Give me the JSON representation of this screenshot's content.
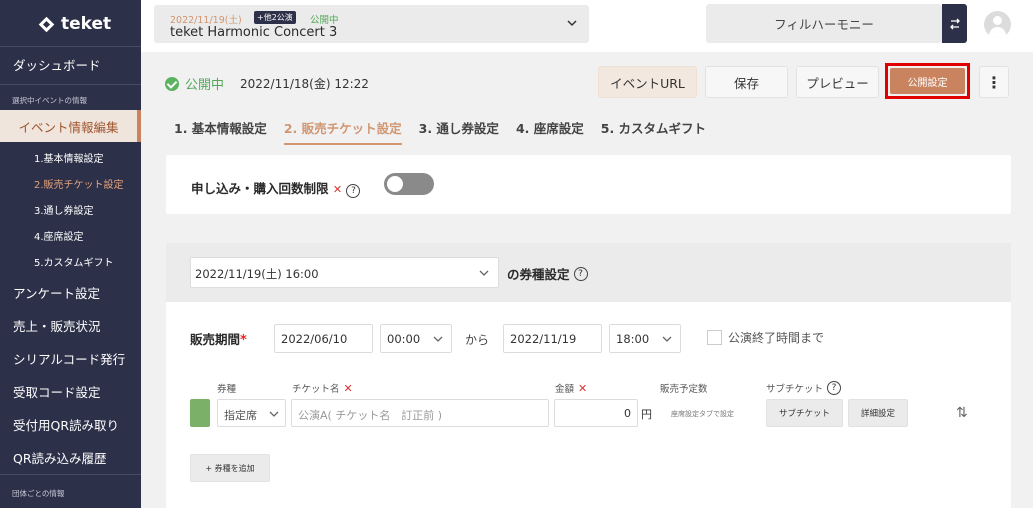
{
  "app": {
    "brand": "teket"
  },
  "sidebar": {
    "dashboard": "ダッシュボード",
    "section_selected_event": "選択中イベントの情報",
    "event_edit": "イベント情報編集",
    "sub_items": [
      "1.基本情報設定",
      "2.販売チケット設定",
      "3.通し券設定",
      "4.座席設定",
      "5.カスタムギフト"
    ],
    "items": [
      "アンケート設定",
      "売上・販売状況",
      "シリアルコード発行",
      "受取コード設定",
      "受付用QR読み取り",
      "QR読み込み履歴"
    ],
    "section_group": "団体ごとの情報"
  },
  "topbar": {
    "event_date": "2022/11/19(土)",
    "multi_badge": "+他2公演",
    "event_status": "公開中",
    "event_title": "teket Harmonic Concert 3",
    "organization": "フィルハーモニー"
  },
  "status": {
    "label": "公開中",
    "datetime": "2022/11/18(金) 12:22"
  },
  "header_buttons": {
    "event_url": "イベントURL",
    "save": "保存",
    "preview": "プレビュー",
    "publish_settings": "公開設定"
  },
  "tabs": [
    "1. 基本情報設定",
    "2. 販売チケット設定",
    "3. 通し券設定",
    "4. 座席設定",
    "5. カスタムギフト"
  ],
  "purchase_limit": {
    "label": "申し込み・購入回数制限",
    "enabled": false
  },
  "ticket_settings": {
    "performance": "2022/11/19(土) 16:00",
    "performance_suffix": "の券種設定",
    "period_label": "販売期間",
    "start_date": "2022/06/10",
    "start_time": "00:00",
    "from": "から",
    "end_date": "2022/11/19",
    "end_time": "18:00",
    "until_end_label": "公演終了時間まで",
    "columns": {
      "type": "券種",
      "name": "チケット名",
      "price": "金額",
      "planned": "販売予定数",
      "sub": "サブチケット"
    },
    "row": {
      "type": "指定席",
      "name_placeholder": "公演A( チケット名　訂正前 )",
      "price": "0",
      "yen": "円",
      "planned": "座席設定タブで設定",
      "sub_ticket_button": "サブチケット",
      "detail_button": "詳細設定",
      "swatch_color": "#7ab068"
    },
    "add_type_button": "+ 券種を追加"
  },
  "colors": {
    "sidebar": "#2d3049",
    "accent": "#c9845f",
    "status_green": "#55a85a",
    "highlight_border": "#e00000"
  }
}
